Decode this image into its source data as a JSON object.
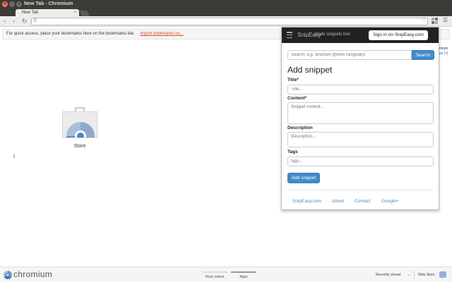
{
  "window": {
    "title": "New Tab - Chromium"
  },
  "tab": {
    "label": "New Tab"
  },
  "omnibox": {
    "value": "",
    "placeholder": ""
  },
  "bookmarks_bar": {
    "message": "For quick access, place your bookmarks here on the bookmarks bar.",
    "import_link": "Import bookmarks no..."
  },
  "newtab": {
    "app_label": "Store",
    "peek_line1": "mium",
    "peek_line2": "ps [×]"
  },
  "footer": {
    "brand": "chromium",
    "tabs": [
      "Most visited",
      "Apps"
    ],
    "recently_closed": "Recently closed",
    "recently_closed_arrow": "⌄",
    "web_store": "Web Store"
  },
  "popup": {
    "brand": "SnipEasy",
    "tagline": "Code snippets tool",
    "signin_label": "Sign in on SnipEasy.com",
    "search_placeholder": "Search: e.g. directive @elvis #angularjs",
    "search_button": "Search",
    "heading": "Add snippet",
    "title_label": "Title*",
    "title_placeholder": "Title...",
    "content_label": "Content*",
    "content_placeholder": "Snippet content...",
    "description_label": "Description",
    "description_placeholder": "Description...",
    "tags_label": "Tags",
    "tags_placeholder": "tags...",
    "add_button": "Add snippet",
    "links": [
      "SnipEasy.com",
      "About",
      "Contact",
      "Google+"
    ]
  },
  "colors": {
    "accent": "#428bca",
    "titlebar": "#3c3b37",
    "popup_header": "#222222",
    "import_link": "#d14b2a"
  }
}
